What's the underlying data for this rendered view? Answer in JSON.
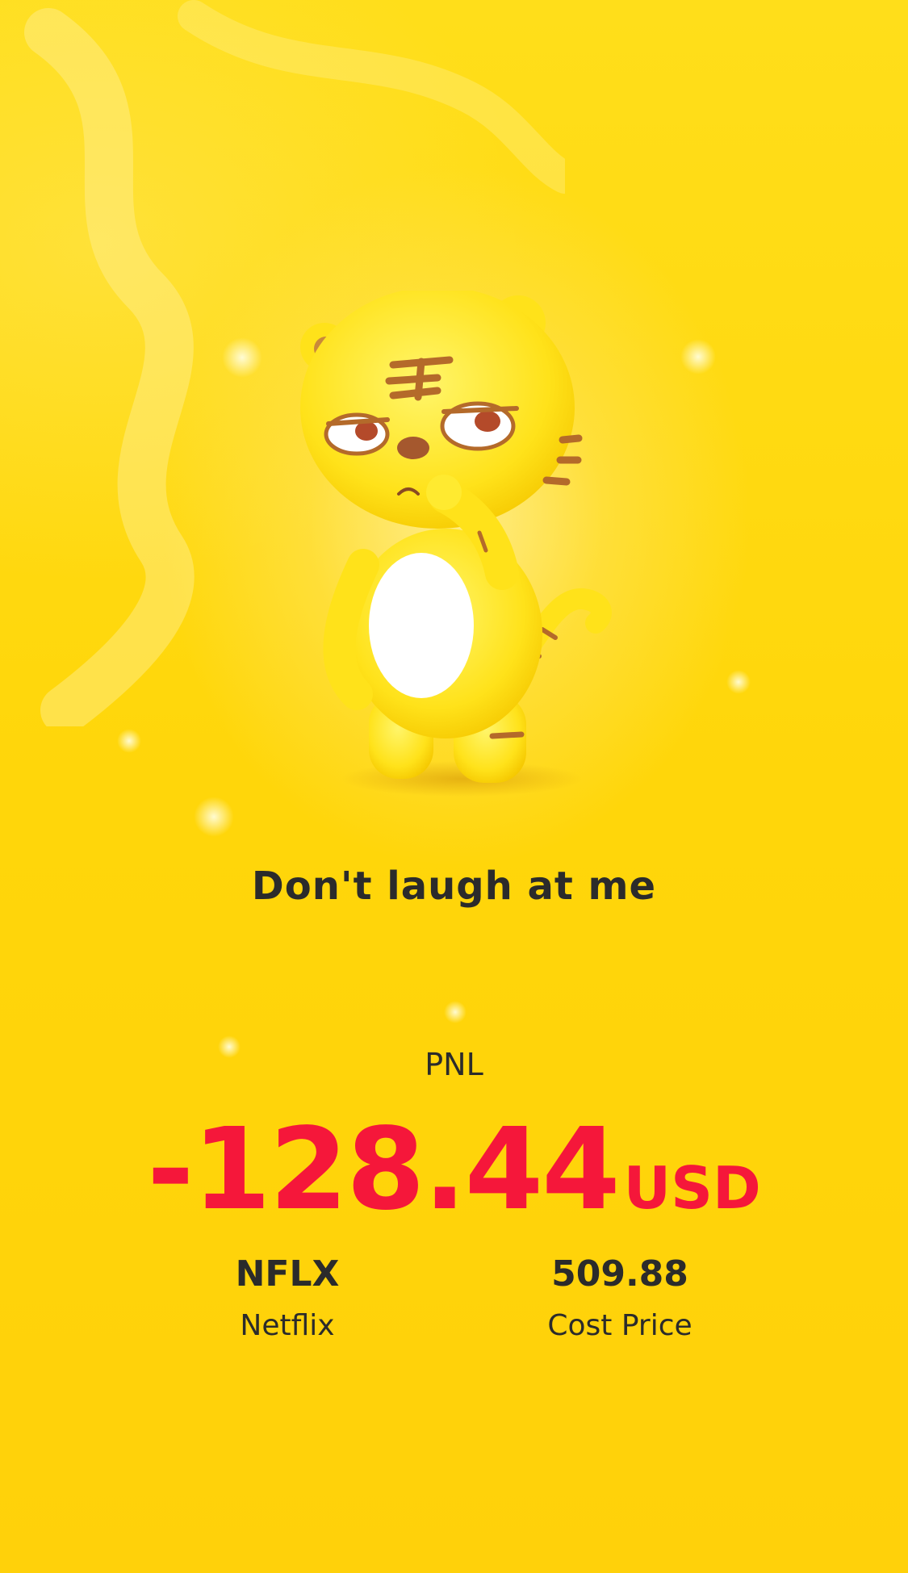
{
  "card": {
    "slogan": "Don't laugh at me",
    "pnl_label": "PNL",
    "pnl_value": "-128.44",
    "pnl_currency": "USD"
  },
  "stock": {
    "symbol": "NFLX",
    "name": "Netflix"
  },
  "cost": {
    "value": "509.88",
    "label": "Cost Price"
  },
  "colors": {
    "background": "#FFD60A",
    "loss": "#F5173A",
    "text": "#2B2B2B"
  },
  "mascot": {
    "icon": "tiger-mascot-icon"
  }
}
